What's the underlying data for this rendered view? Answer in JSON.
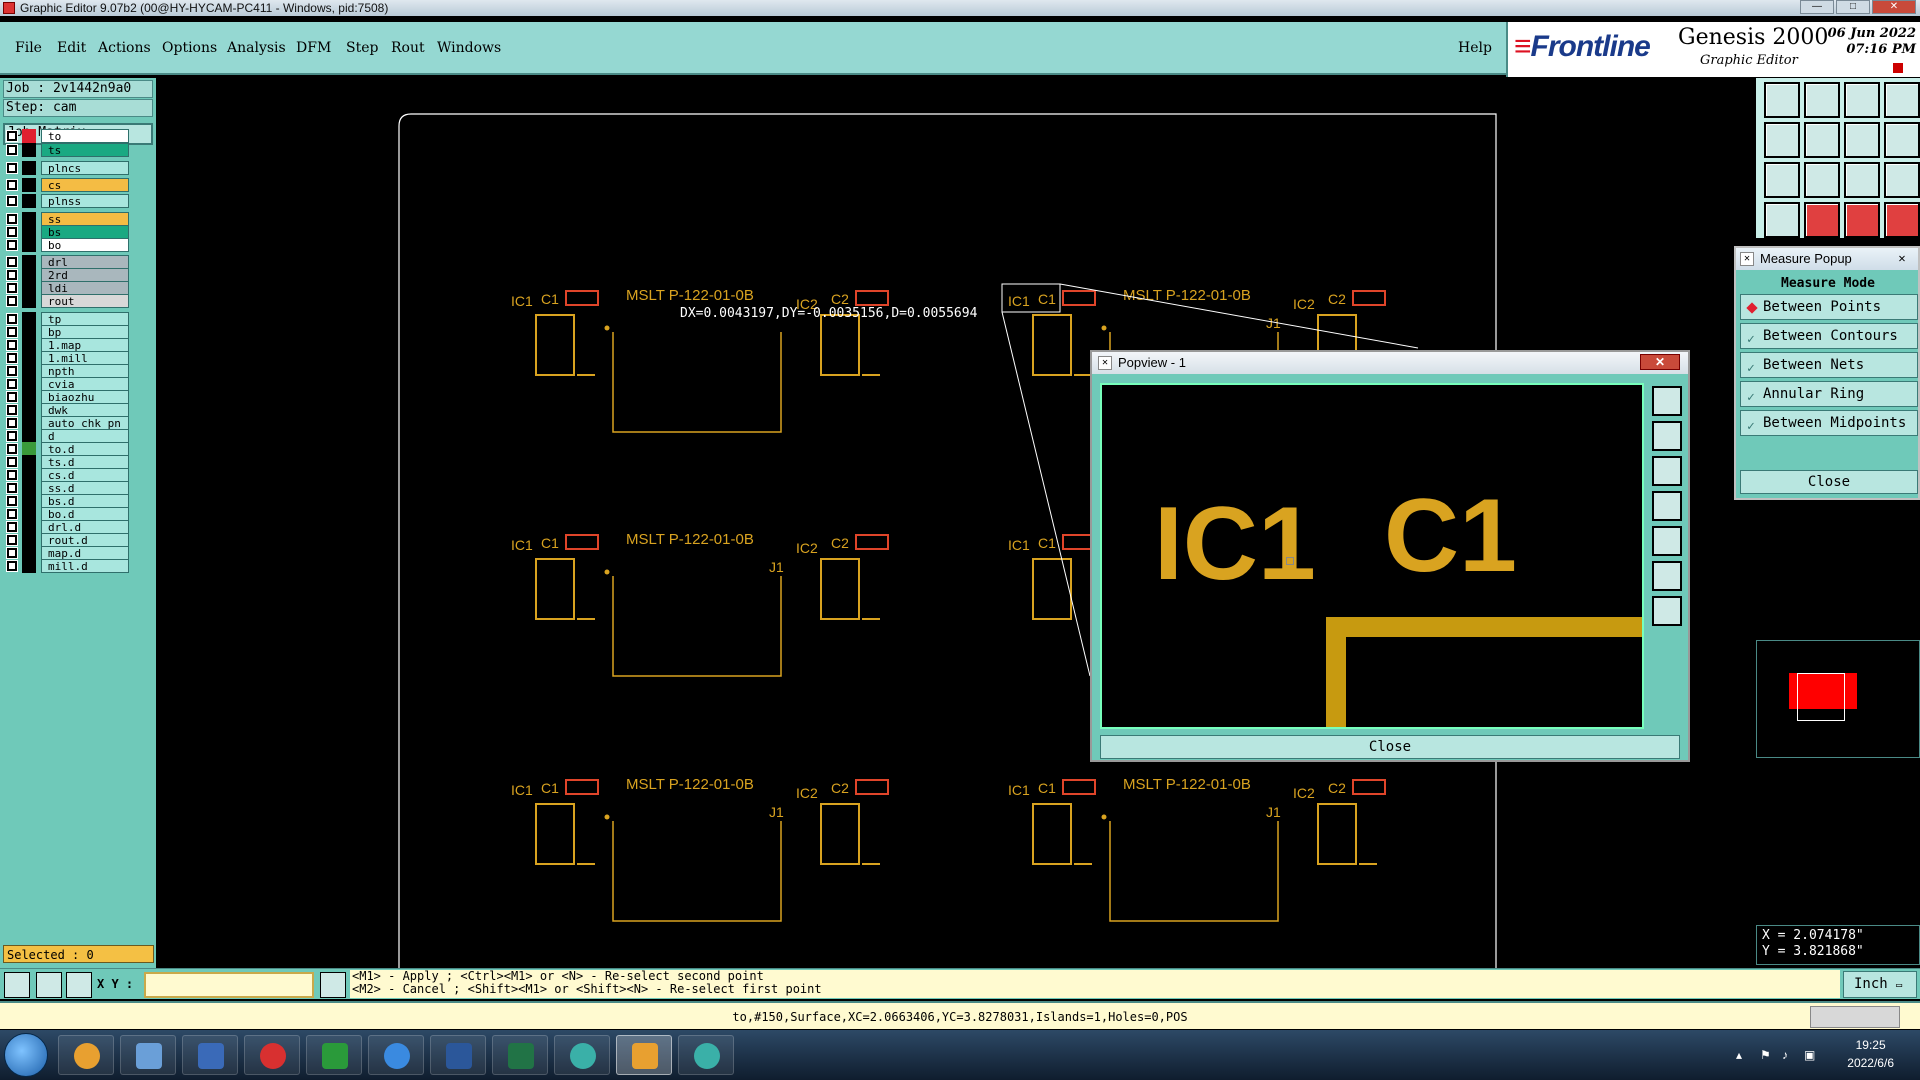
{
  "window": {
    "title": "Graphic Editor 9.07b2 (00@HY-HYCAM-PC411 - Windows, pid:7508)"
  },
  "menu": [
    "File",
    "Edit",
    "Actions",
    "Options",
    "Analysis",
    "DFM",
    "Step",
    "Rout",
    "Windows"
  ],
  "help_label": "Help",
  "brand": {
    "logo": "Frontline",
    "product": "Genesis 2000",
    "subtitle": "Graphic Editor",
    "date": "06 Jun 2022",
    "time": "07:16 PM"
  },
  "job": {
    "job_label": "Job : 2v1442n9a0",
    "step_label": "Step: cam",
    "matrix_button": "Job Matrix ..."
  },
  "layers": [
    {
      "name": "to",
      "color": "#ffffff"
    },
    {
      "name": "ts",
      "color": "#1aa982"
    },
    {
      "name": "plncs",
      "color": "#a8e6de"
    },
    {
      "name": "cs",
      "color": "#f4bc44"
    },
    {
      "name": "plnss",
      "color": "#a8e6de"
    },
    {
      "name": "ss",
      "color": "#f4bc44"
    },
    {
      "name": "bs",
      "color": "#1aa982"
    },
    {
      "name": "bo",
      "color": "#ffffff"
    },
    {
      "name": "drl",
      "color": "#a9b7bd"
    },
    {
      "name": "2rd",
      "color": "#a9b7bd"
    },
    {
      "name": "ldi",
      "color": "#a9b7bd"
    },
    {
      "name": "rout",
      "color": "#d8d8d8"
    },
    {
      "name": "tp",
      "color": "#a8e6de"
    },
    {
      "name": "bp",
      "color": "#a8e6de"
    },
    {
      "name": "1.map",
      "color": "#a8e6de"
    },
    {
      "name": "1.mill",
      "color": "#a8e6de"
    },
    {
      "name": "npth",
      "color": "#a8e6de"
    },
    {
      "name": "cvia",
      "color": "#a8e6de"
    },
    {
      "name": "biaozhu",
      "color": "#a8e6de"
    },
    {
      "name": "dwk",
      "color": "#a8e6de"
    },
    {
      "name": "auto_chk_pn",
      "color": "#a8e6de"
    },
    {
      "name": "d",
      "color": "#a8e6de"
    },
    {
      "name": "to.d",
      "color": "#a8e6de"
    },
    {
      "name": "ts.d",
      "color": "#a8e6de"
    },
    {
      "name": "cs.d",
      "color": "#a8e6de"
    },
    {
      "name": "ss.d",
      "color": "#a8e6de"
    },
    {
      "name": "bs.d",
      "color": "#a8e6de"
    },
    {
      "name": "bo.d",
      "color": "#a8e6de"
    },
    {
      "name": "drl.d",
      "color": "#a8e6de"
    },
    {
      "name": "rout.d",
      "color": "#a8e6de"
    },
    {
      "name": "map.d",
      "color": "#a8e6de"
    },
    {
      "name": "mill.d",
      "color": "#a8e6de"
    }
  ],
  "selected_label": "Selected : 0",
  "canvas": {
    "measure_text": "DX=0.0043197,DY=-0.0035156,D=0.0055694",
    "labels": {
      "ic1": "IC1",
      "c1": "C1",
      "ic2": "IC2",
      "c2": "C2",
      "part": "MSLT P-122-01-0B",
      "j1": "J1"
    }
  },
  "measure_popup": {
    "title": "Measure Popup",
    "mode_label": "Measure Mode",
    "options": [
      "Between Points",
      "Between Contours",
      "Between Nets",
      "Annular Ring",
      "Between Midpoints"
    ],
    "selected": "Between Points",
    "close_label": "Close"
  },
  "popview": {
    "title": "Popview - 1",
    "close_label": "Close",
    "zoom_ic1": "IC1",
    "zoom_c1": "C1"
  },
  "cursor": {
    "x": "X = 2.074178\"",
    "y": "Y = 3.821868\""
  },
  "cmd": {
    "xy_label": "X Y :",
    "hint_line1": "<M1> - Apply  ; <Ctrl><M1> or <N> - Re-select second point",
    "hint_line2": "<M2> - Cancel ; <Shift><M1> or <Shift><N> - Re-select first point",
    "units": "Inch"
  },
  "status_text": "to,#150,Surface,XC=2.0663406,YC=3.8278031,Islands=1,Holes=0,POS",
  "taskbar": {
    "time": "19:25",
    "date": "2022/6/6"
  },
  "colors": {
    "accent": "#95d8d2",
    "silk": "#d9a320",
    "pad": "#e0452a",
    "board_outline": "#ffffff"
  }
}
